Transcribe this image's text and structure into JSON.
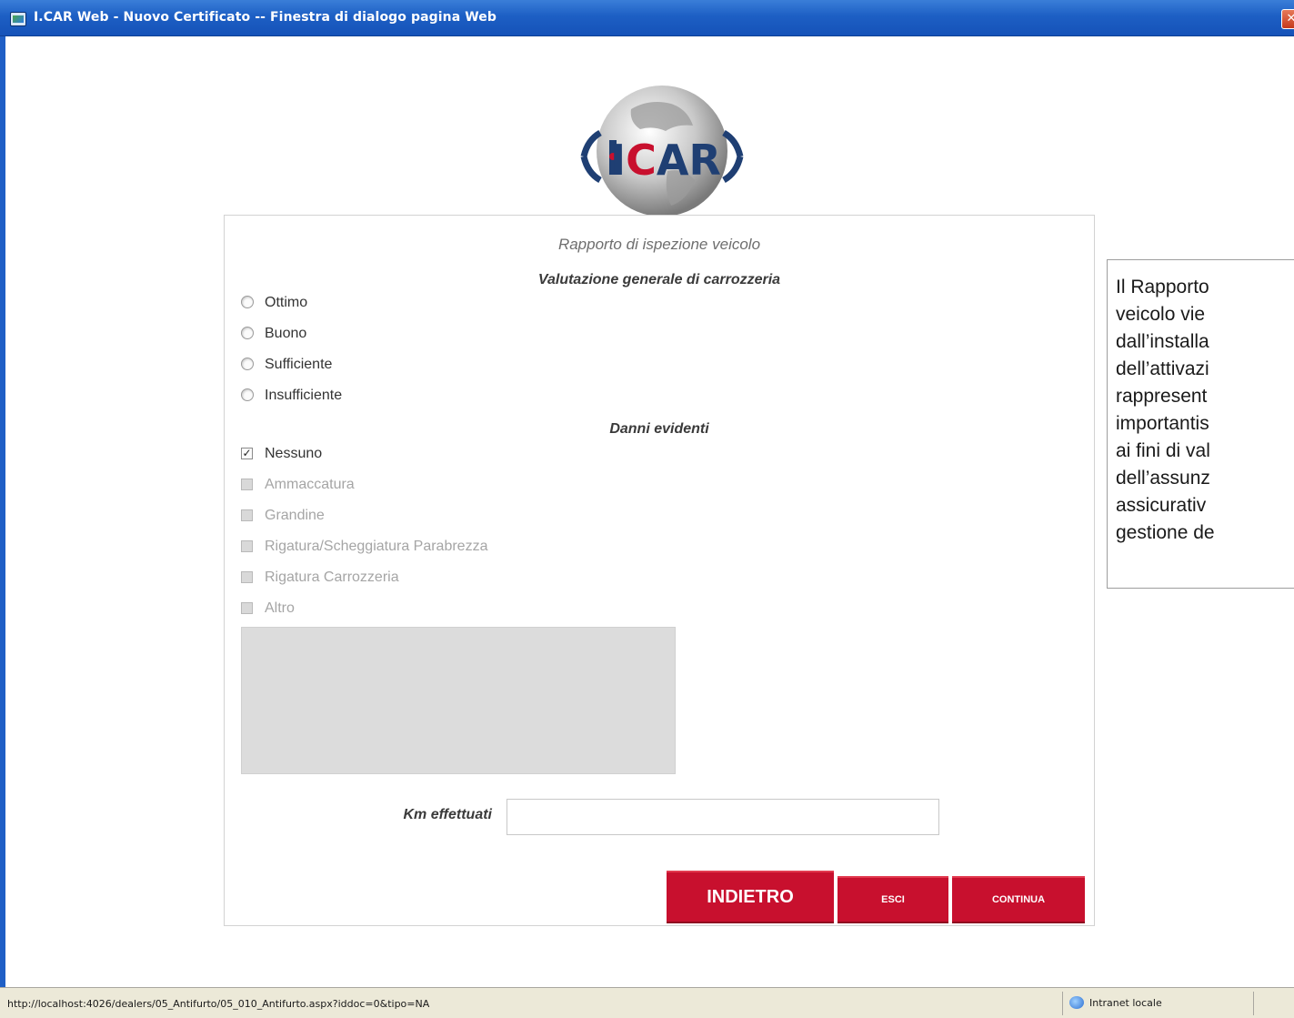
{
  "window": {
    "title": "I.CAR Web - Nuovo Certificato -- Finestra di dialogo pagina Web",
    "close_glyph": "✕"
  },
  "logo": {
    "text": "ICAR",
    "accent_color": "#c8102e",
    "text_color": "#1f3f73"
  },
  "form": {
    "title": "Rapporto di ispezione veicolo",
    "evaluation": {
      "heading": "Valutazione generale di carrozzeria",
      "options": [
        {
          "label": "Ottimo",
          "selected": false
        },
        {
          "label": "Buono",
          "selected": false
        },
        {
          "label": "Sufficiente",
          "selected": false
        },
        {
          "label": "Insufficiente",
          "selected": false
        }
      ]
    },
    "damage": {
      "heading": "Danni evidenti",
      "options": [
        {
          "label": "Nessuno",
          "checked": true,
          "enabled": true
        },
        {
          "label": "Ammaccatura",
          "checked": false,
          "enabled": false
        },
        {
          "label": "Grandine",
          "checked": false,
          "enabled": false
        },
        {
          "label": "Rigatura/Scheggiatura Parabrezza",
          "checked": false,
          "enabled": false
        },
        {
          "label": "Rigatura Carrozzeria",
          "checked": false,
          "enabled": false
        },
        {
          "label": "Altro",
          "checked": false,
          "enabled": false
        }
      ],
      "check_glyph": "✓"
    },
    "notes_value": "",
    "km": {
      "label": "Km effettuati",
      "value": ""
    },
    "buttons": {
      "back": "Indietro",
      "exit": "Esci",
      "continue": "Continua"
    }
  },
  "callout": {
    "lines": [
      "Il Rapporto",
      "veicolo vie",
      "dall’installa",
      "dell’attivazi",
      "rappresent",
      "importantis",
      "ai fini di val",
      "dell’assunz",
      "assicurativ",
      "gestione de"
    ]
  },
  "statusbar": {
    "url": "http://localhost:4026/dealers/05_Antifurto/05_010_Antifurto.aspx?iddoc=0&tipo=NA",
    "zone": "Intranet locale",
    "zone_icon": "globe-icon"
  },
  "colors": {
    "titlebar": "#1d5fc4",
    "button_red": "#c8102e",
    "statusbar": "#ece9d8"
  }
}
